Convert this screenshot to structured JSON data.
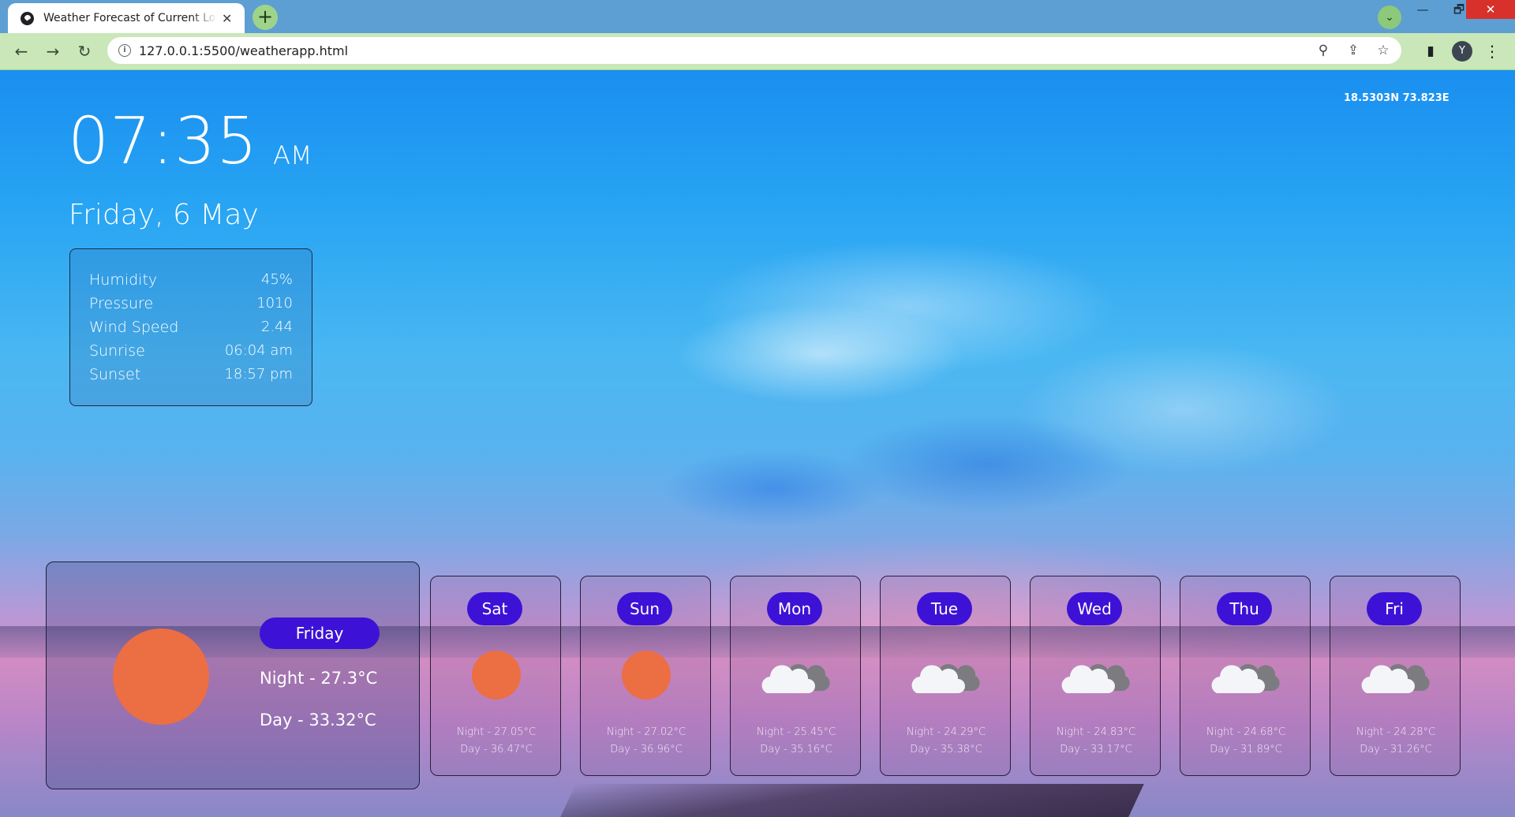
{
  "browser": {
    "tab_title": "Weather Forecast of Current Location",
    "tab_close": "✕",
    "new_tab": "+",
    "profile_initial": "Y",
    "url": "127.0.0.1:5500/weatherapp.html",
    "window_controls": {
      "minimize": "—",
      "maximize": "🗗",
      "close": "✕"
    },
    "icons": {
      "back": "arrow-left-icon",
      "forward": "arrow-right-icon",
      "reload": "reload-icon",
      "info": "info-icon",
      "location": "location-pin-icon",
      "share": "share-icon",
      "bookmark": "star-icon",
      "side_panel": "side-panel-icon",
      "menu": "kebab-menu-icon"
    }
  },
  "clock": {
    "time": "07:35",
    "ampm": "AM",
    "date": "Friday, 6 May"
  },
  "coordinates": "18.5303N 73.823E",
  "details": [
    {
      "label": "Humidity",
      "value": "45%"
    },
    {
      "label": "Pressure",
      "value": "1010"
    },
    {
      "label": "Wind Speed",
      "value": "2.44"
    },
    {
      "label": "Sunrise",
      "value": "06:04 am"
    },
    {
      "label": "Sunset",
      "value": "18:57 pm"
    }
  ],
  "today": {
    "day": "Friday",
    "night": "Night - 27.3°C",
    "day_temp": "Day - 33.32°C",
    "icon": "sun-icon"
  },
  "forecast": [
    {
      "day": "Sat",
      "icon": "sun-icon",
      "night": "Night - 27.05°C",
      "day_temp": "Day - 36.47°C"
    },
    {
      "day": "Sun",
      "icon": "sun-icon",
      "night": "Night - 27.02°C",
      "day_temp": "Day - 36.96°C"
    },
    {
      "day": "Mon",
      "icon": "cloud-icon",
      "night": "Night - 25.45°C",
      "day_temp": "Day - 35.16°C"
    },
    {
      "day": "Tue",
      "icon": "cloud-icon",
      "night": "Night - 24.29°C",
      "day_temp": "Day - 35.38°C"
    },
    {
      "day": "Wed",
      "icon": "cloud-icon",
      "night": "Night - 24.83°C",
      "day_temp": "Day - 33.17°C"
    },
    {
      "day": "Thu",
      "icon": "cloud-icon",
      "night": "Night - 24.68°C",
      "day_temp": "Day - 31.89°C"
    },
    {
      "day": "Fri",
      "icon": "cloud-icon",
      "night": "Night - 24.28°C",
      "day_temp": "Day - 31.26°C"
    }
  ],
  "colors": {
    "badge": "#3d12d6",
    "sun": "#ec6e43",
    "toolbar": "#c9e7b8",
    "tabbar": "#5d9fd3"
  }
}
